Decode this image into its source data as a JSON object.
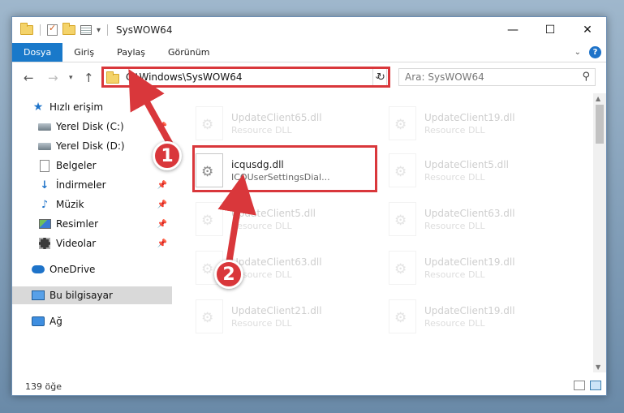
{
  "window": {
    "title": "SysWOW64"
  },
  "ribbon": {
    "tabs": [
      {
        "label": "Dosya",
        "active": true
      },
      {
        "label": "Giriş",
        "active": false
      },
      {
        "label": "Paylaş",
        "active": false
      },
      {
        "label": "Görünüm",
        "active": false
      }
    ]
  },
  "address": {
    "path": "C:\\Windows\\SysWOW64"
  },
  "search": {
    "placeholder": "Ara: SysWOW64"
  },
  "sidebar": {
    "items": [
      {
        "label": "Hızlı erişim"
      },
      {
        "label": "Yerel Disk (C:)"
      },
      {
        "label": "Yerel Disk (D:)"
      },
      {
        "label": "Belgeler"
      },
      {
        "label": "İndirmeler"
      },
      {
        "label": "Müzik"
      },
      {
        "label": "Resimler"
      },
      {
        "label": "Videolar"
      },
      {
        "label": "OneDrive"
      },
      {
        "label": "Bu bilgisayar"
      },
      {
        "label": "Ağ"
      }
    ]
  },
  "files": [
    {
      "name": "UpdateClient65.dll",
      "desc": "Resource DLL"
    },
    {
      "name": "UpdateClient19.dll",
      "desc": "Resource DLL"
    },
    {
      "name": "icqusdg.dll",
      "desc": "ICQUserSettingsDial..."
    },
    {
      "name": "UpdateClient5.dll",
      "desc": "Resource DLL"
    },
    {
      "name": "UpdateClient5.dll",
      "desc": "Resource DLL"
    },
    {
      "name": "UpdateClient63.dll",
      "desc": "Resource DLL"
    },
    {
      "name": "UpdateClient63.dll",
      "desc": "Resource DLL"
    },
    {
      "name": "UpdateClient19.dll",
      "desc": "Resource DLL"
    },
    {
      "name": "UpdateClient21.dll",
      "desc": "Resource DLL"
    },
    {
      "name": "UpdateClient19.dll",
      "desc": "Resource DLL"
    }
  ],
  "status": {
    "count": "139 öğe"
  },
  "annotations": {
    "step1": "1",
    "step2": "2"
  },
  "colors": {
    "accent": "#1979ca",
    "highlight": "#d9373b"
  }
}
